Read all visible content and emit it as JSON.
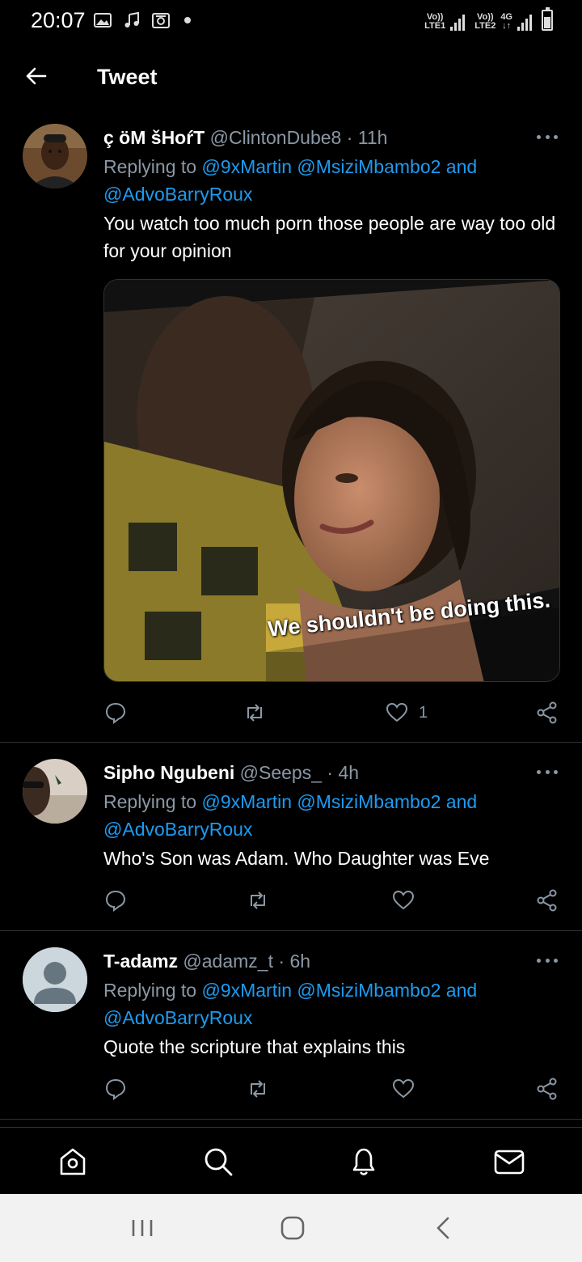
{
  "status_bar": {
    "time": "20:07",
    "sim1_label": "Vo))",
    "sim1_sub": "LTE1",
    "sim2_label": "Vo))",
    "sim2_sub": "LTE2",
    "network": "4G",
    "icons": [
      "image-icon",
      "music-icon",
      "radio-icon",
      "dot-icon"
    ]
  },
  "header": {
    "title": "Tweet",
    "back_icon": "arrow-left-icon"
  },
  "tweets": [
    {
      "name": "ç öM šHoŕT",
      "handle": "@ClintonDube8",
      "separator": "·",
      "time": "11h",
      "replying_prefix": "Replying to",
      "mentions_line1": "@9xMartin @MsiziMbambo2",
      "and_word": "and",
      "mentions_line2": "@AdvoBarryRoux",
      "text": "You watch too much porn those people are way too old for your opinion",
      "media_caption": "We shouldn't be doing this.",
      "like_count": "1"
    },
    {
      "name": "Sipho Ngubeni",
      "handle": "@Seeps_",
      "separator": "·",
      "time": "4h",
      "replying_prefix": "Replying to",
      "mentions_line1": "@9xMartin @MsiziMbambo2",
      "and_word": "and",
      "mentions_line2": "@AdvoBarryRoux",
      "text": "Who's Son was Adam. Who Daughter was Eve",
      "like_count": ""
    },
    {
      "name": "T-adamz",
      "handle": "@adamz_t",
      "separator": "·",
      "time": "6h",
      "replying_prefix": "Replying to",
      "mentions_line1": "@9xMartin @MsiziMbambo2",
      "and_word": "and",
      "mentions_line2": "@AdvoBarryRoux",
      "text": "Quote the scripture that explains this",
      "like_count": ""
    }
  ],
  "colors": {
    "background": "#000000",
    "mention": "#1d9bf0",
    "secondary_text": "#8b98a5",
    "divider": "#2f3336"
  },
  "tabbar": [
    "home-icon",
    "search-icon",
    "bell-icon",
    "mail-icon"
  ],
  "system_nav": [
    "recents-icon",
    "home-circle-icon",
    "back-chevron-icon"
  ]
}
